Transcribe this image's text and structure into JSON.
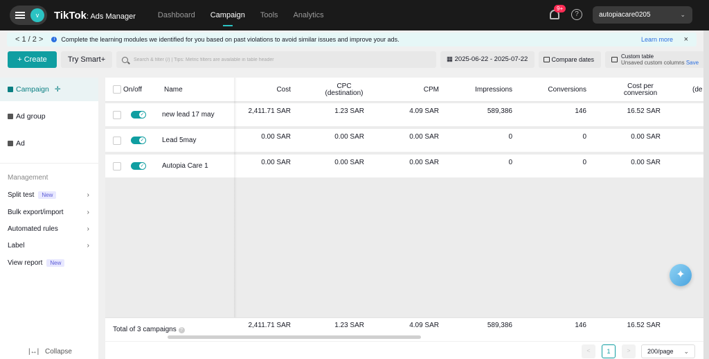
{
  "topbar": {
    "avatar_letter": "v",
    "brand": "TikTok",
    "brand_sub": ": Ads Manager",
    "tabs": [
      {
        "label": "Dashboard",
        "active": false
      },
      {
        "label": "Campaign",
        "active": true
      },
      {
        "label": "Tools",
        "active": false
      },
      {
        "label": "Analytics",
        "active": false
      }
    ],
    "notification_count": "9+",
    "account_name": "autopiacare0205"
  },
  "banner": {
    "pager": "< 1 / 2 >",
    "message": "Complete the learning modules we identified for you based on past violations to avoid similar issues and improve your ads.",
    "learn_more": "Learn more",
    "close": "×"
  },
  "toolbar": {
    "create_label": "+ Create",
    "smart_label": "Try Smart+",
    "search_placeholder": "Search & filter (/) | Tips: Metric filters are available in table header",
    "date_range": "2025-06-22 - 2025-07-22",
    "compare_label": "Compare dates",
    "custom_table_title": "Custom table",
    "custom_table_sub": "Unsaved custom columns",
    "custom_table_save": "Save"
  },
  "sidebar": {
    "levels": [
      {
        "label": "Campaign",
        "active": true
      },
      {
        "label": "Ad group",
        "active": false
      },
      {
        "label": "Ad",
        "active": false
      }
    ],
    "management_title": "Management",
    "management_items": [
      {
        "label": "Split test",
        "badge": "New"
      },
      {
        "label": "Bulk export/import",
        "badge": ""
      },
      {
        "label": "Automated rules",
        "badge": ""
      },
      {
        "label": "Label",
        "badge": ""
      },
      {
        "label": "View report",
        "badge": "New"
      }
    ],
    "collapse_label": "Collapse"
  },
  "table": {
    "columns": {
      "onoff": "On/off",
      "name": "Name",
      "cost": "Cost",
      "cpc_line1": "CPC",
      "cpc_line2": "(destination)",
      "cpm": "CPM",
      "impressions": "Impressions",
      "conversions": "Conversions",
      "cpconv_line1": "Cost per",
      "cpconv_line2": "conversion",
      "extra": "(de"
    },
    "rows": [
      {
        "name": "new lead 17 may",
        "cost": "2,411.71 SAR",
        "cpc": "1.23 SAR",
        "cpm": "4.09 SAR",
        "impressions": "589,386",
        "conversions": "146",
        "cpconv": "16.52 SAR"
      },
      {
        "name": "Lead 5may",
        "cost": "0.00 SAR",
        "cpc": "0.00 SAR",
        "cpm": "0.00 SAR",
        "impressions": "0",
        "conversions": "0",
        "cpconv": "0.00 SAR"
      },
      {
        "name": "Autopia Care 1",
        "cost": "0.00 SAR",
        "cpc": "0.00 SAR",
        "cpm": "0.00 SAR",
        "impressions": "0",
        "conversions": "0",
        "cpconv": "0.00 SAR"
      }
    ],
    "total": {
      "label": "Total of 3 campaigns",
      "cost": "2,411.71 SAR",
      "cpc": "1.23 SAR",
      "cpm": "4.09 SAR",
      "impressions": "589,386",
      "conversions": "146",
      "cpconv": "16.52 SAR"
    }
  },
  "pagination": {
    "prev": "<",
    "current": "1",
    "next": ">",
    "page_size": "200/page"
  },
  "colors": {
    "accent": "#109ea1",
    "topbar": "#1a1a1a",
    "badge": "#fe2c55"
  }
}
